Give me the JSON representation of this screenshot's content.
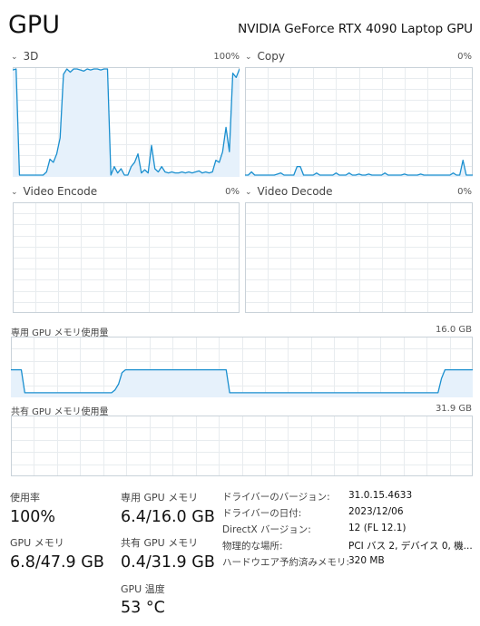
{
  "header": {
    "title": "GPU",
    "gpu_name": "NVIDIA GeForce RTX 4090 Laptop GPU"
  },
  "panels": {
    "engine_3d": {
      "label": "3D",
      "max": "100%",
      "utilization": [
        99,
        100,
        0,
        0,
        0,
        0,
        0,
        0,
        0,
        0,
        3,
        15,
        12,
        20,
        35,
        95,
        100,
        97,
        100,
        100,
        99,
        98,
        100,
        99,
        100,
        100,
        99,
        100,
        100,
        0,
        8,
        2,
        6,
        0,
        0,
        8,
        12,
        20,
        2,
        5,
        2,
        28,
        6,
        3,
        8,
        3,
        2,
        3,
        2,
        2,
        3,
        2,
        3,
        2,
        3,
        4,
        2,
        3,
        2,
        3,
        14,
        12,
        22,
        45,
        22,
        96,
        92,
        100
      ]
    },
    "copy": {
      "label": "Copy",
      "max": "0%",
      "utilization": [
        0,
        0,
        3,
        0,
        0,
        0,
        0,
        0,
        0,
        0,
        1,
        2,
        0,
        0,
        0,
        0,
        8,
        8,
        0,
        0,
        0,
        0,
        2,
        0,
        0,
        0,
        0,
        0,
        2,
        0,
        0,
        0,
        2,
        0,
        0,
        1,
        0,
        0,
        1,
        0,
        0,
        0,
        0,
        2,
        0,
        0,
        0,
        0,
        0,
        1,
        0,
        0,
        0,
        0,
        1,
        0,
        0,
        0,
        0,
        0,
        0,
        0,
        0,
        0,
        2,
        0,
        0,
        14,
        0,
        0,
        0
      ]
    },
    "video_encode": {
      "label": "Video Encode",
      "max": "0%"
    },
    "video_decode": {
      "label": "Video Decode",
      "max": "0%"
    },
    "dedicated_memory": {
      "label": "専用 GPU メモリ使用量",
      "max": "16.0 GB",
      "usage_fraction": [
        0.45,
        0.45,
        0.45,
        0.45,
        0.05,
        0.05,
        0.05,
        0.05,
        0.05,
        0.05,
        0.05,
        0.05,
        0.05,
        0.05,
        0.05,
        0.05,
        0.05,
        0.05,
        0.05,
        0.05,
        0.05,
        0.05,
        0.05,
        0.05,
        0.05,
        0.05,
        0.05,
        0.05,
        0.05,
        0.05,
        0.1,
        0.2,
        0.4,
        0.45,
        0.45,
        0.45,
        0.45,
        0.45,
        0.45,
        0.45,
        0.45,
        0.45,
        0.45,
        0.45,
        0.45,
        0.45,
        0.45,
        0.45,
        0.45,
        0.45,
        0.45,
        0.45,
        0.45,
        0.45,
        0.45,
        0.45,
        0.45,
        0.45,
        0.45,
        0.45,
        0.45,
        0.45,
        0.45,
        0.05,
        0.05,
        0.05,
        0.05,
        0.05,
        0.05,
        0.05,
        0.05,
        0.05,
        0.05,
        0.05,
        0.05,
        0.05,
        0.05,
        0.05,
        0.05,
        0.05,
        0.05,
        0.05,
        0.05,
        0.05,
        0.05,
        0.05,
        0.05,
        0.05,
        0.05,
        0.05,
        0.05,
        0.05,
        0.05,
        0.05,
        0.05,
        0.05,
        0.05,
        0.05,
        0.05,
        0.05,
        0.05,
        0.05,
        0.05,
        0.05,
        0.05,
        0.05,
        0.05,
        0.05,
        0.05,
        0.05,
        0.05,
        0.05,
        0.05,
        0.05,
        0.05,
        0.05,
        0.05,
        0.05,
        0.05,
        0.05,
        0.05,
        0.05,
        0.05,
        0.05,
        0.3,
        0.45,
        0.45,
        0.45,
        0.45,
        0.45,
        0.45,
        0.45,
        0.45,
        0.45
      ]
    },
    "shared_memory": {
      "label": "共有 GPU メモリ使用量",
      "max": "31.9 GB"
    }
  },
  "stats": {
    "utilization": {
      "label": "使用率",
      "value": "100%"
    },
    "dedicated": {
      "label": "専用 GPU メモリ",
      "value": "6.4/16.0 GB"
    },
    "gpu_memory": {
      "label": "GPU メモリ",
      "value": "6.8/47.9 GB"
    },
    "shared": {
      "label": "共有 GPU メモリ",
      "value": "0.4/31.9 GB"
    },
    "temperature": {
      "label": "GPU 温度",
      "value": "53 °C"
    }
  },
  "info": [
    {
      "key": "ドライバーのバージョン:",
      "value": "31.0.15.4633"
    },
    {
      "key": "ドライバーの日付:",
      "value": "2023/12/06"
    },
    {
      "key": "DirectX バージョン:",
      "value": "12 (FL 12.1)"
    },
    {
      "key": "物理的な場所:",
      "value": "PCI バス 2, デバイス 0, 機..."
    },
    {
      "key": "ハードウエア予約済みメモリ:",
      "value": "320 MB"
    }
  ],
  "colors": {
    "line": "#1a8fcf",
    "fill": "#e6f1fb",
    "grid": "#e8ecef",
    "border": "#c9d2d9"
  }
}
